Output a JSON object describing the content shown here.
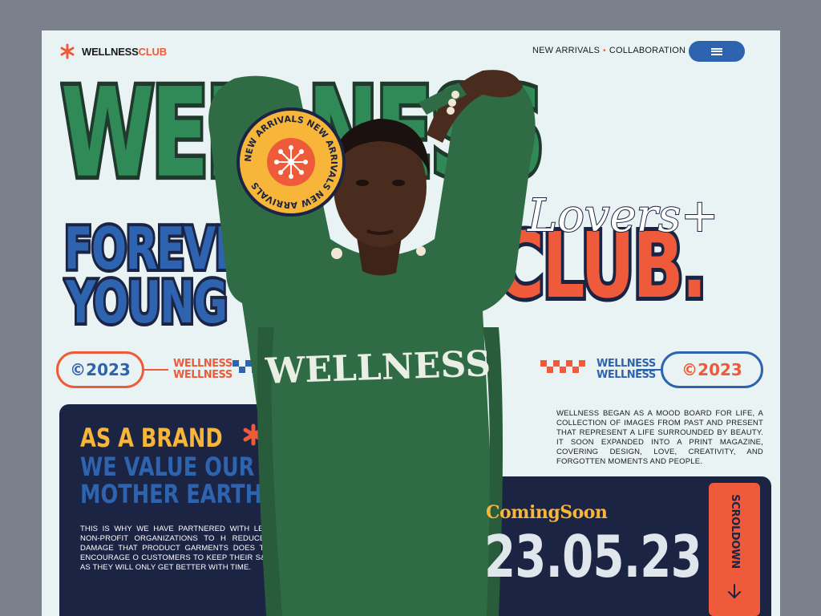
{
  "header": {
    "logo_prefix": "WELLNESS",
    "logo_suffix": "CLUB",
    "nav": [
      "NEW ARRIVALS",
      "COLLABORATION"
    ],
    "nav_separator": "•",
    "menu_icon": "hamburger-icon"
  },
  "hero": {
    "big_word": "WELLNESS",
    "line1": "FOREVER",
    "line2": "YOUNG",
    "club": "CLUB.",
    "graffiti_tag": "Lovers+",
    "badge_text": "NEW ARRIVALS NEW ARRIVALS NEW ARRIVALS",
    "shirt_text": "WELLNESS"
  },
  "strip": {
    "year_left": "©2023",
    "tag_left": [
      "WELLNESS",
      "WELLNESS"
    ],
    "year_right": "©2023",
    "tag_right": [
      "WELLNESS",
      "WELLNESS"
    ]
  },
  "brand_card": {
    "heading1": "AS A BRAND",
    "heading2": "WE VALUE OUR MOTHER EARTH.",
    "body": "THIS IS WHY WE HAVE PARTNERED WITH LEAD ENVIRONMENTAL NON-PROFIT ORGANIZATIONS TO H REDUCE AND OFFSET THE DAMAGE THAT PRODUCT GARMENTS DOES TO OUR PLANET. WE ENCOURAGE O CUSTOMERS TO KEEP THEIR S&R PIECES FOREVER, AS THEY WILL ONLY GET BETTER WITH TIME."
  },
  "about": {
    "text": "WELLNESS BEGAN AS A MOOD BOARD FOR LIFE, A COLLECTION OF IMAGES FROM PAST AND PRESENT THAT REPRESENT A LIFE SURROUNDED BY BEAUTY. IT SOON EXPANDED INTO A PRINT MAGAZINE, COVERING DESIGN, LOVE, CREATIVITY, AND FORGOTTEN MOMENTS AND PEOPLE."
  },
  "coming_soon": {
    "title": "ComingSoon",
    "date": "23.05.23",
    "scroll_label": "SCROLDOWN"
  },
  "colors": {
    "green": "#2f8a57",
    "blue": "#2e63b0",
    "orange": "#ee5a3a",
    "yellow": "#f7b53a",
    "navy": "#1c2444",
    "background": "#e9f3f3"
  }
}
